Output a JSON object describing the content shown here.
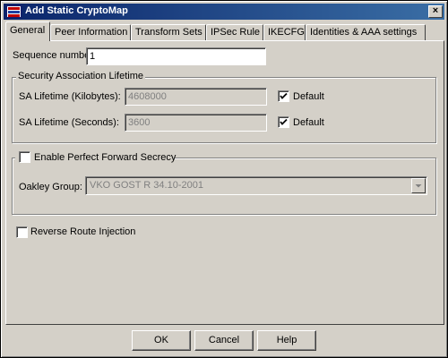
{
  "window": {
    "title": "Add Static CryptoMap",
    "close_glyph": "×",
    "icon": "cryptomap-app-icon"
  },
  "tabs": [
    {
      "label": "General",
      "active": true
    },
    {
      "label": "Peer Information",
      "active": false
    },
    {
      "label": "Transform Sets",
      "active": false
    },
    {
      "label": "IPSec Rule",
      "active": false
    },
    {
      "label": "IKECFG",
      "active": false
    },
    {
      "label": "Identities & AAA settings",
      "active": false
    }
  ],
  "general": {
    "sequence_label": "Sequence number:",
    "sequence_value": "1",
    "sa_group": {
      "title": "Security Association Lifetime",
      "kilobytes_label": "SA Lifetime (Kilobytes):",
      "kilobytes_value": "4608000",
      "kilobytes_default_label": "Default",
      "kilobytes_default_checked": true,
      "seconds_label": "SA Lifetime (Seconds):",
      "seconds_value": "3600",
      "seconds_default_label": "Default",
      "seconds_default_checked": true
    },
    "pfs_group": {
      "checkbox_label": "Enable Perfect Forward Secrecy",
      "checked": false,
      "oakley_label": "Oakley Group:",
      "oakley_value": "VKO GOST R 34.10-2001"
    },
    "rri": {
      "label": "Reverse Route Injection",
      "checked": false
    }
  },
  "buttons": {
    "ok": "OK",
    "cancel": "Cancel",
    "help": "Help"
  }
}
